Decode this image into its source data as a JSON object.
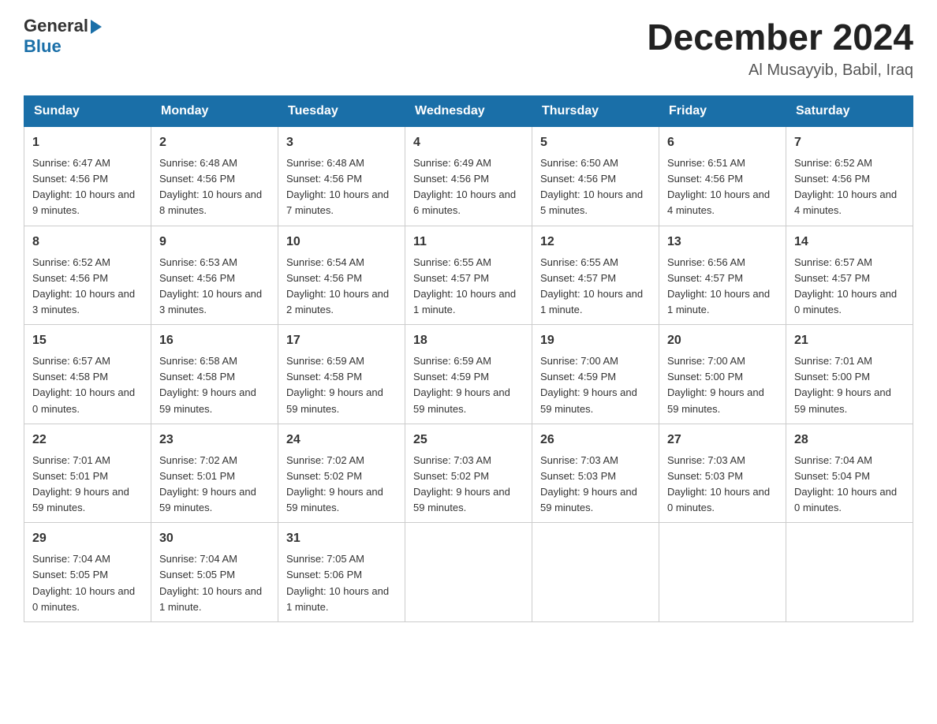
{
  "header": {
    "logo_general": "General",
    "logo_blue": "Blue",
    "month_title": "December 2024",
    "location": "Al Musayyib, Babil, Iraq"
  },
  "days_of_week": [
    "Sunday",
    "Monday",
    "Tuesday",
    "Wednesday",
    "Thursday",
    "Friday",
    "Saturday"
  ],
  "weeks": [
    [
      {
        "day": "1",
        "sunrise": "6:47 AM",
        "sunset": "4:56 PM",
        "daylight": "10 hours and 9 minutes."
      },
      {
        "day": "2",
        "sunrise": "6:48 AM",
        "sunset": "4:56 PM",
        "daylight": "10 hours and 8 minutes."
      },
      {
        "day": "3",
        "sunrise": "6:48 AM",
        "sunset": "4:56 PM",
        "daylight": "10 hours and 7 minutes."
      },
      {
        "day": "4",
        "sunrise": "6:49 AM",
        "sunset": "4:56 PM",
        "daylight": "10 hours and 6 minutes."
      },
      {
        "day": "5",
        "sunrise": "6:50 AM",
        "sunset": "4:56 PM",
        "daylight": "10 hours and 5 minutes."
      },
      {
        "day": "6",
        "sunrise": "6:51 AM",
        "sunset": "4:56 PM",
        "daylight": "10 hours and 4 minutes."
      },
      {
        "day": "7",
        "sunrise": "6:52 AM",
        "sunset": "4:56 PM",
        "daylight": "10 hours and 4 minutes."
      }
    ],
    [
      {
        "day": "8",
        "sunrise": "6:52 AM",
        "sunset": "4:56 PM",
        "daylight": "10 hours and 3 minutes."
      },
      {
        "day": "9",
        "sunrise": "6:53 AM",
        "sunset": "4:56 PM",
        "daylight": "10 hours and 3 minutes."
      },
      {
        "day": "10",
        "sunrise": "6:54 AM",
        "sunset": "4:56 PM",
        "daylight": "10 hours and 2 minutes."
      },
      {
        "day": "11",
        "sunrise": "6:55 AM",
        "sunset": "4:57 PM",
        "daylight": "10 hours and 1 minute."
      },
      {
        "day": "12",
        "sunrise": "6:55 AM",
        "sunset": "4:57 PM",
        "daylight": "10 hours and 1 minute."
      },
      {
        "day": "13",
        "sunrise": "6:56 AM",
        "sunset": "4:57 PM",
        "daylight": "10 hours and 1 minute."
      },
      {
        "day": "14",
        "sunrise": "6:57 AM",
        "sunset": "4:57 PM",
        "daylight": "10 hours and 0 minutes."
      }
    ],
    [
      {
        "day": "15",
        "sunrise": "6:57 AM",
        "sunset": "4:58 PM",
        "daylight": "10 hours and 0 minutes."
      },
      {
        "day": "16",
        "sunrise": "6:58 AM",
        "sunset": "4:58 PM",
        "daylight": "9 hours and 59 minutes."
      },
      {
        "day": "17",
        "sunrise": "6:59 AM",
        "sunset": "4:58 PM",
        "daylight": "9 hours and 59 minutes."
      },
      {
        "day": "18",
        "sunrise": "6:59 AM",
        "sunset": "4:59 PM",
        "daylight": "9 hours and 59 minutes."
      },
      {
        "day": "19",
        "sunrise": "7:00 AM",
        "sunset": "4:59 PM",
        "daylight": "9 hours and 59 minutes."
      },
      {
        "day": "20",
        "sunrise": "7:00 AM",
        "sunset": "5:00 PM",
        "daylight": "9 hours and 59 minutes."
      },
      {
        "day": "21",
        "sunrise": "7:01 AM",
        "sunset": "5:00 PM",
        "daylight": "9 hours and 59 minutes."
      }
    ],
    [
      {
        "day": "22",
        "sunrise": "7:01 AM",
        "sunset": "5:01 PM",
        "daylight": "9 hours and 59 minutes."
      },
      {
        "day": "23",
        "sunrise": "7:02 AM",
        "sunset": "5:01 PM",
        "daylight": "9 hours and 59 minutes."
      },
      {
        "day": "24",
        "sunrise": "7:02 AM",
        "sunset": "5:02 PM",
        "daylight": "9 hours and 59 minutes."
      },
      {
        "day": "25",
        "sunrise": "7:03 AM",
        "sunset": "5:02 PM",
        "daylight": "9 hours and 59 minutes."
      },
      {
        "day": "26",
        "sunrise": "7:03 AM",
        "sunset": "5:03 PM",
        "daylight": "9 hours and 59 minutes."
      },
      {
        "day": "27",
        "sunrise": "7:03 AM",
        "sunset": "5:03 PM",
        "daylight": "10 hours and 0 minutes."
      },
      {
        "day": "28",
        "sunrise": "7:04 AM",
        "sunset": "5:04 PM",
        "daylight": "10 hours and 0 minutes."
      }
    ],
    [
      {
        "day": "29",
        "sunrise": "7:04 AM",
        "sunset": "5:05 PM",
        "daylight": "10 hours and 0 minutes."
      },
      {
        "day": "30",
        "sunrise": "7:04 AM",
        "sunset": "5:05 PM",
        "daylight": "10 hours and 1 minute."
      },
      {
        "day": "31",
        "sunrise": "7:05 AM",
        "sunset": "5:06 PM",
        "daylight": "10 hours and 1 minute."
      },
      null,
      null,
      null,
      null
    ]
  ]
}
